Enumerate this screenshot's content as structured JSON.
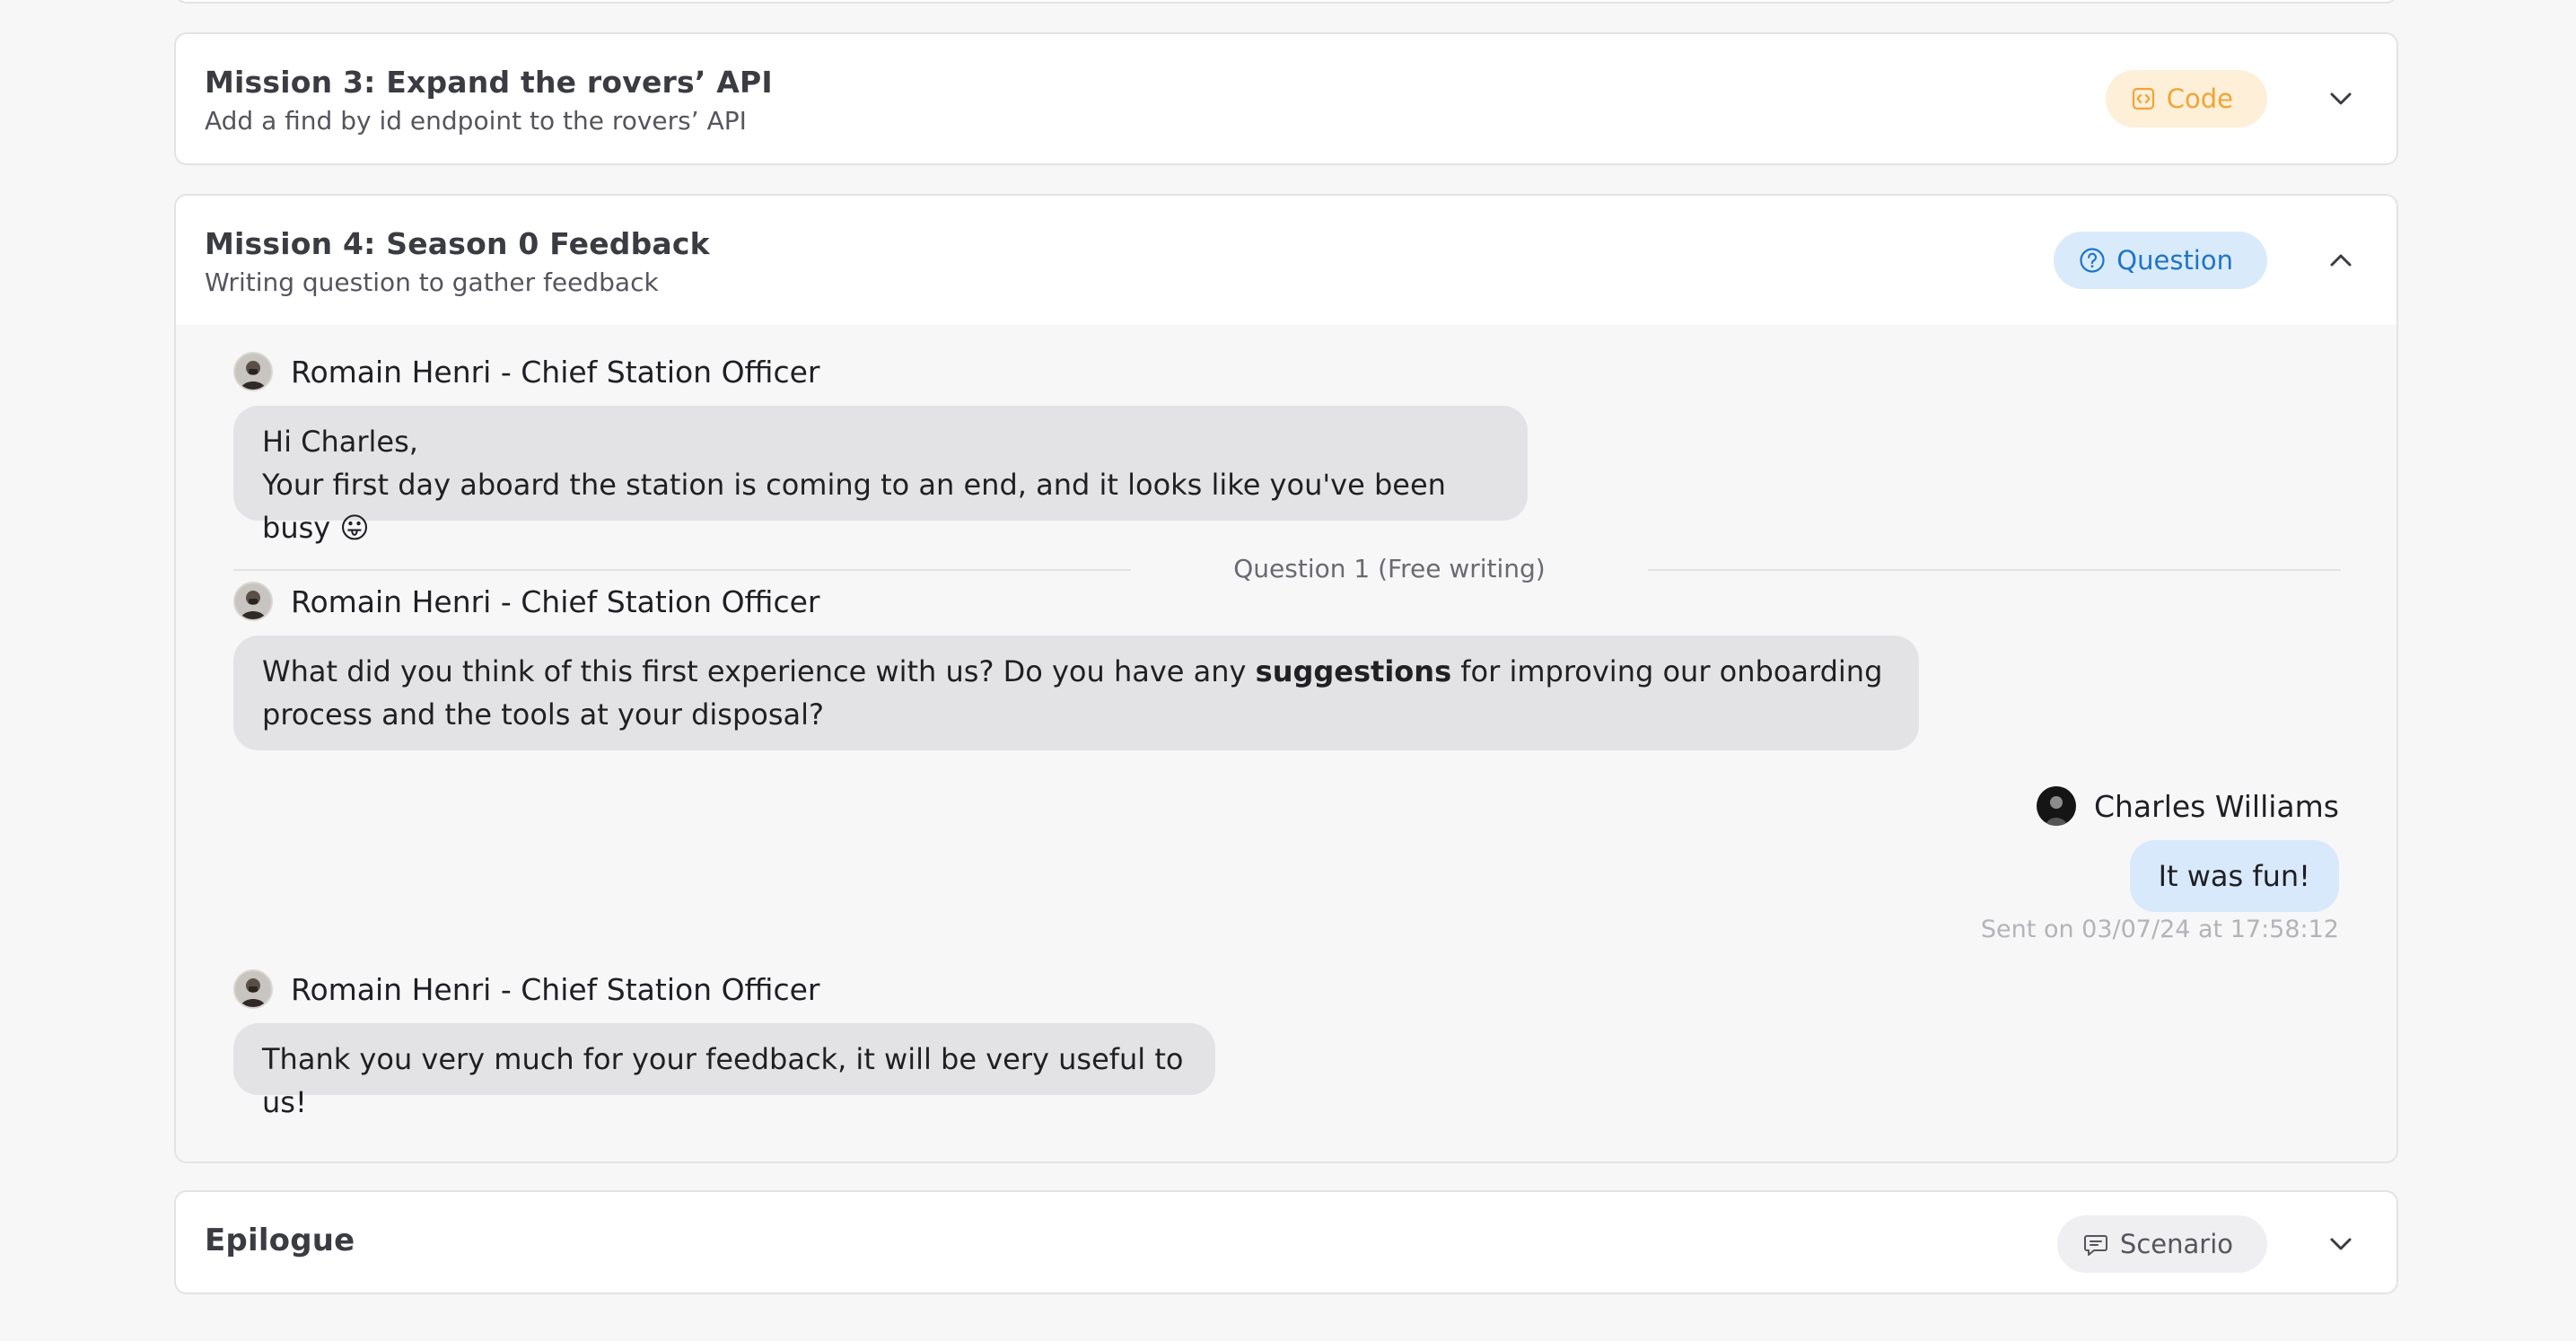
{
  "missions": [
    {
      "title": "Mission 3: Expand the rovers’ API",
      "subtitle": "Add a find by id endpoint to the rovers’ API",
      "tag": "Code",
      "expanded": false
    },
    {
      "title": "Mission 4: Season 0 Feedback",
      "subtitle": "Writing question to gather feedback",
      "tag": "Question",
      "expanded": true
    },
    {
      "title": "Epilogue",
      "tag": "Scenario",
      "expanded": false
    }
  ],
  "conversation": {
    "intro": {
      "sender": "Romain Henri - Chief Station Officer",
      "line1": "Hi Charles,",
      "line2": "Your first day aboard the station is coming to an end, and it looks like you've been busy 😛"
    },
    "divider_label": "Question 1 (Free writing)",
    "question": {
      "sender": "Romain Henri - Chief Station Officer",
      "text_before": "What did you think of this first experience with us? Do you have any ",
      "text_bold": "suggestions",
      "text_after": " for improving our onboarding process and the tools at your disposal?"
    },
    "answer": {
      "sender": "Charles Williams",
      "text": "It was fun!",
      "sent_at": "Sent on 03/07/24 at 17:58:12"
    },
    "reply": {
      "sender": "Romain Henri - Chief Station Officer",
      "text": "Thank you very much for your feedback, it will be very useful to us!"
    }
  },
  "icons": {
    "code_tag": "code-icon",
    "question_tag": "question-circle-icon",
    "scenario_tag": "chat-bubble-icon",
    "expand": "chevron-down-icon",
    "collapse": "chevron-up-icon"
  },
  "colors": {
    "code_tag_bg": "#fdefd8",
    "code_tag_text": "#f0a536",
    "question_tag_bg": "#d9ebfb",
    "question_tag_text": "#1f74c6",
    "user_bubble": "#d8e9fb",
    "bot_bubble": "#e3e3e6"
  }
}
